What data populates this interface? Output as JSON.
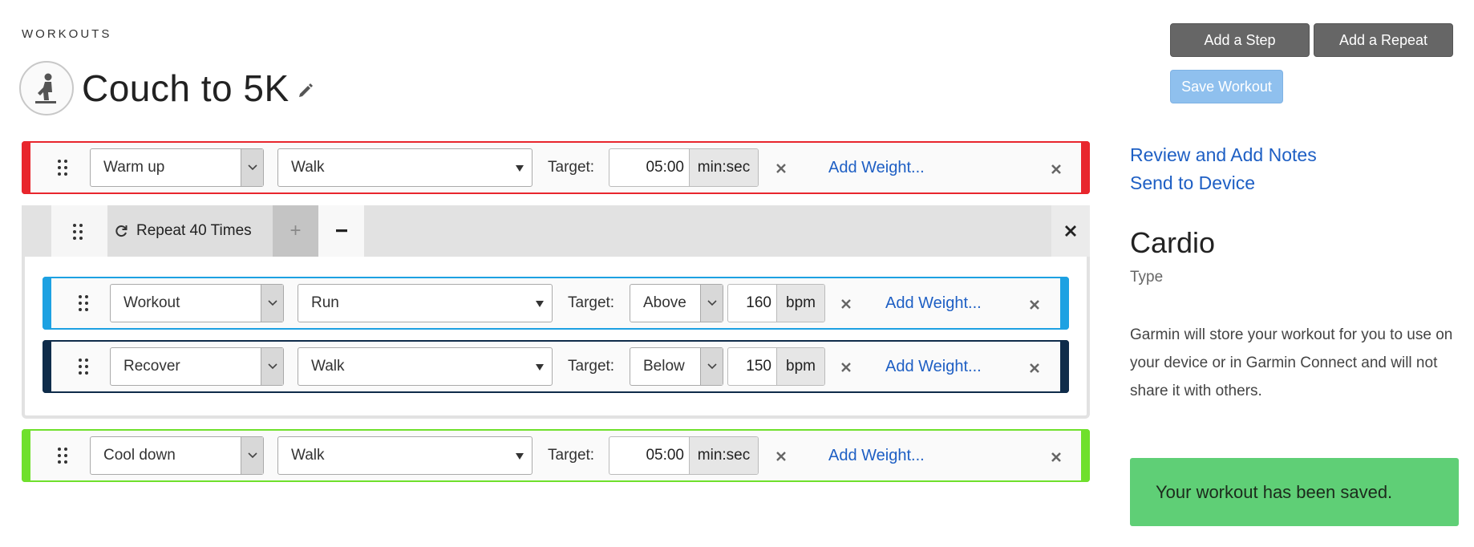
{
  "breadcrumb": "WORKOUTS",
  "workout": {
    "title": "Couch to 5K"
  },
  "toolbar": {
    "add_step": "Add a Step",
    "add_repeat": "Add a Repeat",
    "save_workout": "Save Workout"
  },
  "steps": {
    "warmup": {
      "type": "Warm up",
      "activity": "Walk",
      "target_label": "Target:",
      "value": "05:00",
      "unit": "min:sec",
      "add_weight": "Add Weight...",
      "color": "#e8262d"
    },
    "workout": {
      "type": "Workout",
      "activity": "Run",
      "target_label": "Target:",
      "zone": "Above",
      "value": "160",
      "unit": "bpm",
      "add_weight": "Add Weight...",
      "color": "#1da1e2"
    },
    "recover": {
      "type": "Recover",
      "activity": "Walk",
      "target_label": "Target:",
      "zone": "Below",
      "value": "150",
      "unit": "bpm",
      "add_weight": "Add Weight...",
      "color": "#0f2c4a"
    },
    "cooldown": {
      "type": "Cool down",
      "activity": "Walk",
      "target_label": "Target:",
      "value": "05:00",
      "unit": "min:sec",
      "add_weight": "Add Weight...",
      "color": "#6fe02c"
    }
  },
  "repeat": {
    "label": "Repeat 40 Times",
    "plus": "+"
  },
  "sidebar": {
    "review_notes": "Review and Add Notes",
    "send_device": "Send to Device",
    "sport": "Cardio",
    "type_label": "Type",
    "description": "Garmin will store your workout for you to use on your device or in Garmin Connect and will not share it with others."
  },
  "toast": "Your workout has been saved."
}
